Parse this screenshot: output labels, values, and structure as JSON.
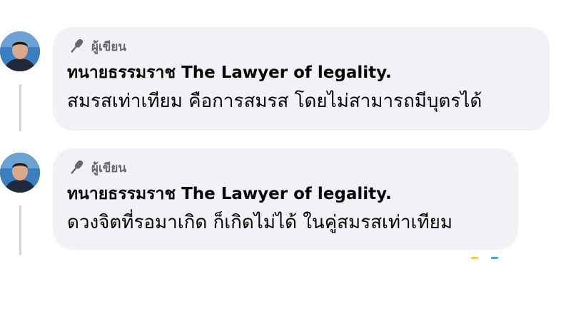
{
  "comments": [
    {
      "badge": "ผู้เขียน",
      "author": "ทนายธรรมราช The Lawyer of legality.",
      "text": "สมรสเท่าเทียม คือการสมรส โดยไม่สามารถมีบุตรได้"
    },
    {
      "badge": "ผู้เขียน",
      "author": "ทนายธรรมราช The Lawyer of legality.",
      "text": "ดวงจิตที่รอมาเกิด ก็เกิดไม่ได้ ในคู่สมรสเท่าเทียม"
    }
  ],
  "icons": {
    "badge_icon": "microphone-icon",
    "avatar": "profile-photo"
  },
  "colors": {
    "bubble_bg": "#f0f2f5",
    "badge_text": "#65676b",
    "thread_line": "#d0d3d8"
  }
}
